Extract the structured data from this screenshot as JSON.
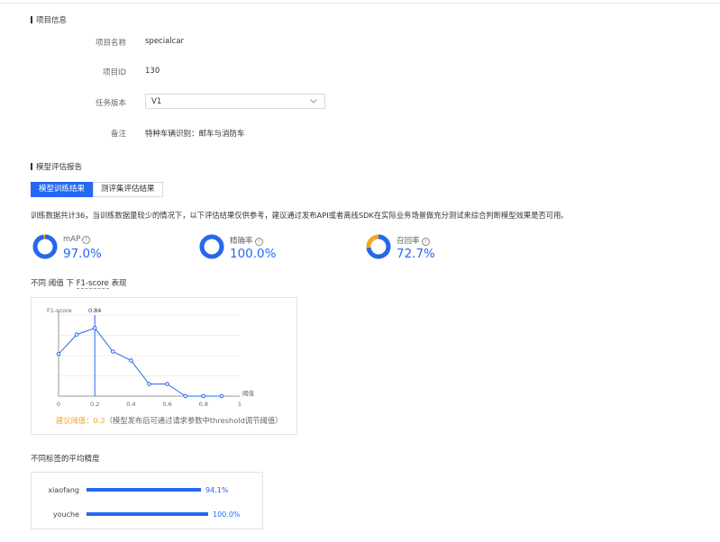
{
  "project_info": {
    "section_title": "项目信息",
    "name_label": "项目名称",
    "name_value": "specialcar",
    "id_label": "项目ID",
    "id_value": "130",
    "version_label": "任务版本",
    "version_value": "V1",
    "remark_label": "备注",
    "remark_value": "特种车辆识别：邮车与消防车"
  },
  "report": {
    "section_title": "模型评估报告",
    "tabs": [
      {
        "label": "模型训练结果",
        "active": true
      },
      {
        "label": "测评集评估结果",
        "active": false
      }
    ],
    "notice": "训练数据共计36，当训练数据量较少的情况下，以下评估结果仅供参考，建议通过发布API或者离线SDK在实际业务场景做充分测试来综合判断模型效果是否可用。",
    "metrics": [
      {
        "name": "mAP",
        "value": "97.0%",
        "fraction": 0.97
      },
      {
        "name": "精确率",
        "value": "100.0%",
        "fraction": 1.0
      },
      {
        "name": "召回率",
        "value": "72.7%",
        "fraction": 0.727
      }
    ],
    "f1_heading": {
      "prefix": "不同 阈值 下",
      "term": "F1-score",
      "suffix": "表现"
    },
    "suggestion": {
      "label": "建议阈值：",
      "value": "0.2",
      "note": "（模型发布后可通过请求参数中threshold调节阈值）"
    },
    "ap_heading": "不同标签的平均精度"
  },
  "colors": {
    "accent": "#2468f2",
    "ring_track": "#f5a623",
    "suggest": "#f5a623"
  },
  "chart_data": [
    {
      "type": "line",
      "ylabel": "F1-score",
      "xlabel": "阈值",
      "x": [
        0,
        0.1,
        0.2,
        0.3,
        0.4,
        0.5,
        0.6,
        0.7,
        0.8,
        0.9
      ],
      "y": [
        0.52,
        0.76,
        0.84,
        0.55,
        0.44,
        0.15,
        0.15,
        0.0,
        0.0,
        0.0
      ],
      "xlim": [
        0,
        1
      ],
      "xticks": [
        "0",
        "0.2",
        "0.4",
        "0.6",
        "0.8",
        "1"
      ],
      "ylim": [
        0,
        1
      ],
      "highlight": {
        "x": 0.2,
        "label": "0.84"
      },
      "grid": true
    },
    {
      "type": "bar",
      "orientation": "horizontal",
      "categories": [
        "xiaofang",
        "youche"
      ],
      "values": [
        94.1,
        100.0
      ],
      "labels": [
        "94.1%",
        "100.0%"
      ],
      "xlim": [
        0,
        100
      ]
    }
  ]
}
